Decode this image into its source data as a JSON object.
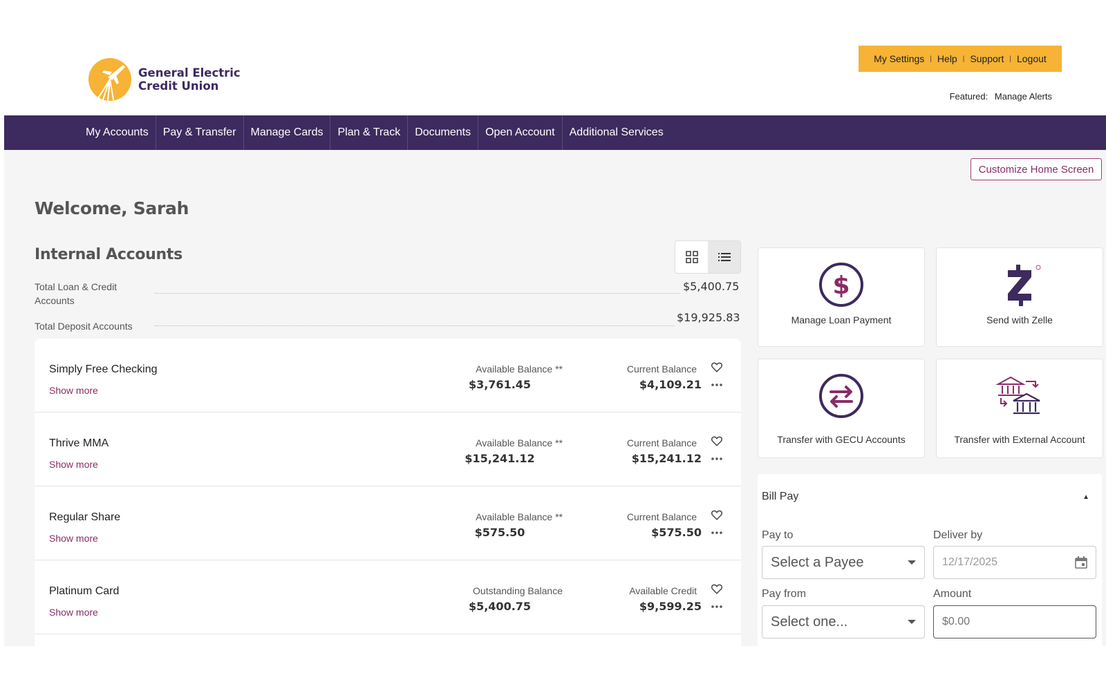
{
  "brand": {
    "name_line1": "General Electric",
    "name_line2": "Credit Union",
    "primary_color": "#3d2a5e",
    "accent_color": "#f6b335",
    "link_color": "#8a2c65"
  },
  "utility_nav": {
    "items": [
      "My Settings",
      "Help",
      "Support",
      "Logout"
    ],
    "separator": "|"
  },
  "featured": {
    "label": "Featured:",
    "link": "Manage Alerts"
  },
  "main_nav": {
    "items": [
      "My Accounts",
      "Pay & Transfer",
      "Manage Cards",
      "Plan & Track",
      "Documents",
      "Open Account",
      "Additional Services"
    ]
  },
  "customize_button": "Customize Home Screen",
  "welcome": "Welcome, Sarah",
  "internal_accounts": {
    "title": "Internal Accounts",
    "summary": [
      {
        "label": "Total Loan & Credit Accounts",
        "value": "$5,400.75"
      },
      {
        "label": "Total Deposit Accounts",
        "value": "$19,925.83"
      }
    ],
    "show_more_label": "Show more",
    "accounts": [
      {
        "name": "Simply Free Checking",
        "label1": "Available Balance **",
        "value1": "$3,761.45",
        "label2": "Current Balance",
        "value2": "$4,109.21"
      },
      {
        "name": "Thrive MMA",
        "label1": "Available Balance **",
        "value1": "$15,241.12",
        "label2": "Current Balance",
        "value2": "$15,241.12"
      },
      {
        "name": "Regular Share",
        "label1": "Available Balance **",
        "value1": "$575.50",
        "label2": "Current Balance",
        "value2": "$575.50"
      },
      {
        "name": "Platinum Card",
        "label1": "Outstanding Balance",
        "value1": "$5,400.75",
        "label2": "Available Credit",
        "value2": "$9,599.25"
      }
    ]
  },
  "quick_actions": [
    {
      "label": "Manage Loan Payment",
      "icon": "dollar-circle-icon"
    },
    {
      "label": "Send with Zelle",
      "icon": "zelle-icon"
    },
    {
      "label": "Transfer with GECU Accounts",
      "icon": "transfer-arrows-icon"
    },
    {
      "label": "Transfer with External Account",
      "icon": "bank-transfer-icon"
    }
  ],
  "bill_pay": {
    "title": "Bill Pay",
    "pay_to_label": "Pay to",
    "pay_to_value": "Select a Payee",
    "deliver_by_label": "Deliver by",
    "deliver_by_value": "12/17/2025",
    "pay_from_label": "Pay from",
    "pay_from_value": "Select one...",
    "amount_label": "Amount",
    "amount_placeholder": "$0.00"
  }
}
